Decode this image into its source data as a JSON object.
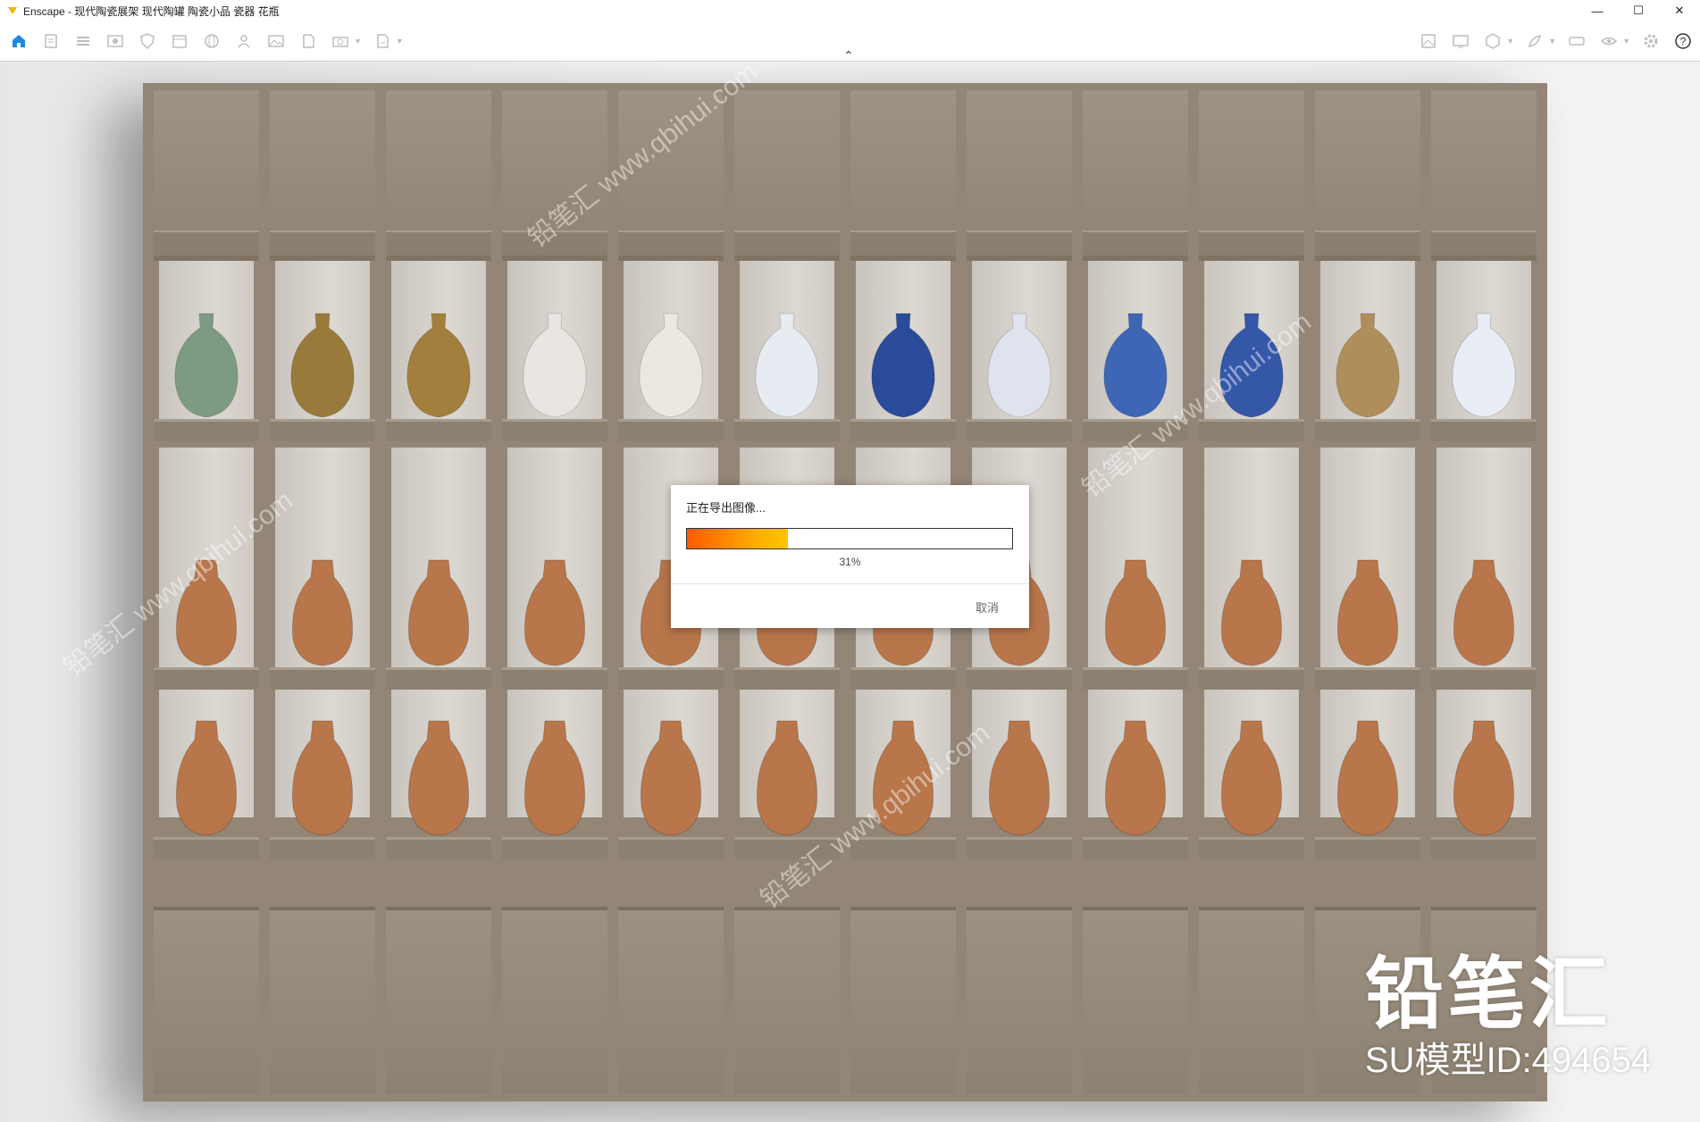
{
  "window": {
    "title": "Enscape - 现代陶瓷展架 现代陶罐 陶瓷小品 瓷器 花瓶",
    "minimize": "—",
    "maximize": "☐",
    "close": "✕",
    "help": "?"
  },
  "toolbar": {
    "left_icons": [
      "home-icon",
      "document-icon",
      "list-icon",
      "eye-screen-icon",
      "shield-icon",
      "calendar-icon",
      "globe-icon",
      "asset-icon",
      "image-icon",
      "render-icon",
      "camera-icon",
      "export-icon"
    ],
    "right_icons": [
      "image-export-icon",
      "screen-icon",
      "cube-icon",
      "feather-icon",
      "vr-headset-icon",
      "visibility-icon",
      "settings-icon",
      "help-icon"
    ],
    "accent_color": "#1e88e5"
  },
  "dialog": {
    "title": "正在导出图像...",
    "progress_percent": 31,
    "progress_text": "31%",
    "cancel_label": "取消",
    "progress_colors": [
      "#ff5a00",
      "#ffc400"
    ]
  },
  "watermark": {
    "brand": "铅笔汇",
    "model_id": "SU模型ID:494654",
    "diagonal_text": "铅笔汇 www.qbihui.com"
  }
}
